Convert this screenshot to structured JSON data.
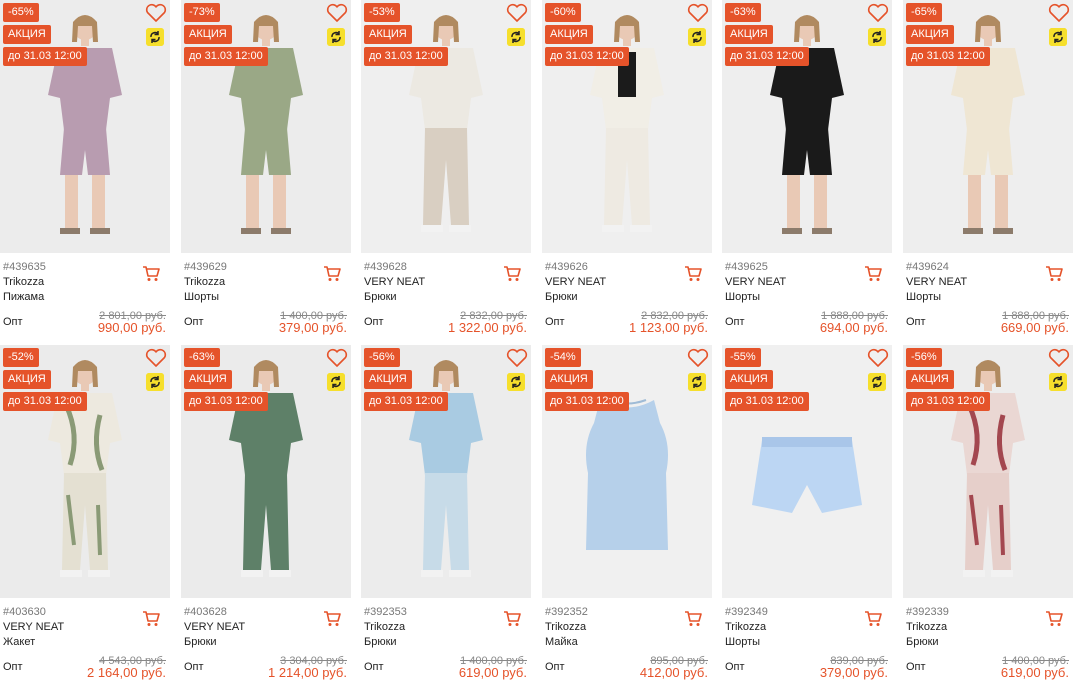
{
  "colors": {
    "accent": "#e5532a",
    "promo_icon": "#f6df2c"
  },
  "icons": {
    "favorite": "heart-icon",
    "cart": "cart-icon",
    "exchange": "exchange-icon"
  },
  "labels": {
    "promo": "АКЦИЯ",
    "deadline": "до 31.03 12:00",
    "wholesale": "Опт"
  },
  "products": [
    {
      "discount": "-65%",
      "sku": "#439635",
      "brand": "Trikozza",
      "type": "Пижама",
      "old_price": "2 801,00 руб.",
      "price": "990,00 руб."
    },
    {
      "discount": "-73%",
      "sku": "#439629",
      "brand": "Trikozza",
      "type": "Шорты",
      "old_price": "1 400,00 руб.",
      "price": "379,00 руб."
    },
    {
      "discount": "-53%",
      "sku": "#439628",
      "brand": "VERY NEAT",
      "type": "Брюки",
      "old_price": "2 832,00 руб.",
      "price": "1 322,00 руб."
    },
    {
      "discount": "-60%",
      "sku": "#439626",
      "brand": "VERY NEAT",
      "type": "Брюки",
      "old_price": "2 832,00 руб.",
      "price": "1 123,00 руб."
    },
    {
      "discount": "-63%",
      "sku": "#439625",
      "brand": "VERY NEAT",
      "type": "Шорты",
      "old_price": "1 888,00 руб.",
      "price": "694,00 руб."
    },
    {
      "discount": "-65%",
      "sku": "#439624",
      "brand": "VERY NEAT",
      "type": "Шорты",
      "old_price": "1 888,00 руб.",
      "price": "669,00 руб."
    },
    {
      "discount": "-52%",
      "sku": "#403630",
      "brand": "VERY NEAT",
      "type": "Жакет",
      "old_price": "4 543,00 руб.",
      "price": "2 164,00 руб."
    },
    {
      "discount": "-63%",
      "sku": "#403628",
      "brand": "VERY NEAT",
      "type": "Брюки",
      "old_price": "3 304,00 руб.",
      "price": "1 214,00 руб."
    },
    {
      "discount": "-56%",
      "sku": "#392353",
      "brand": "Trikozza",
      "type": "Брюки",
      "old_price": "1 400,00 руб.",
      "price": "619,00 руб."
    },
    {
      "discount": "-54%",
      "sku": "#392352",
      "brand": "Trikozza",
      "type": "Майка",
      "old_price": "895,00 руб.",
      "price": "412,00 руб."
    },
    {
      "discount": "-55%",
      "sku": "#392349",
      "brand": "Trikozza",
      "type": "Шорты",
      "old_price": "839,00 руб.",
      "price": "379,00 руб."
    },
    {
      "discount": "-56%",
      "sku": "#392339",
      "brand": "Trikozza",
      "type": "Брюки",
      "old_price": "1 400,00 руб.",
      "price": "619,00 руб."
    }
  ]
}
